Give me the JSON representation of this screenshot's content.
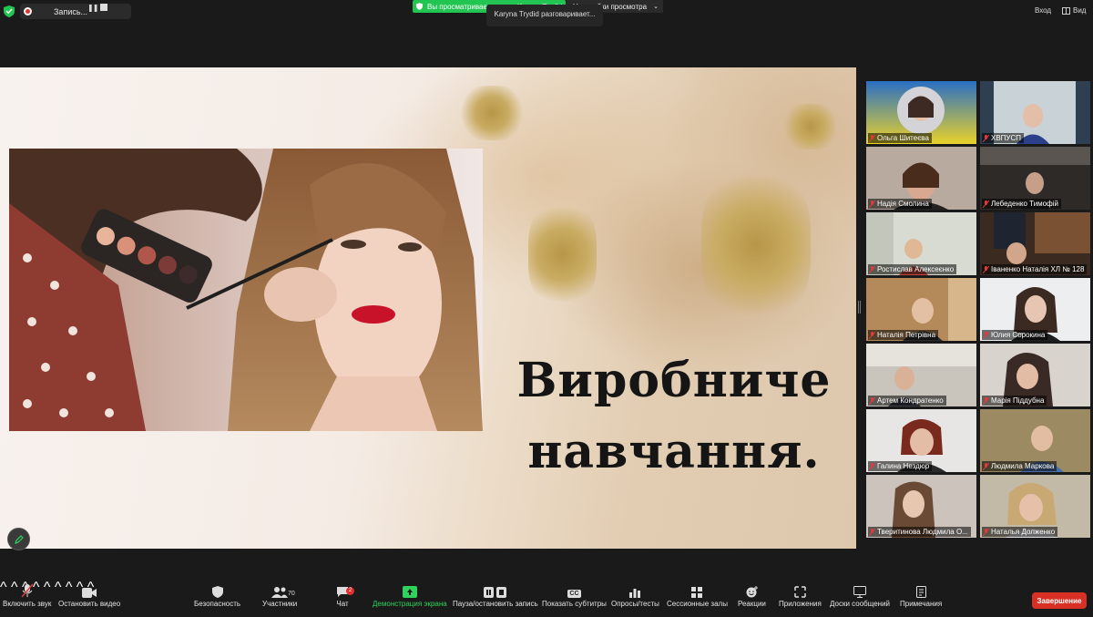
{
  "top_bar": {
    "recording_label": "Запись...",
    "sharing_notice": "Вы просматриваете экран Karyna Trydid",
    "view_options_label": "Настройки просмотра",
    "talking_indicator": "Karyna Trydid разговаривает...",
    "exit_label": "Вход",
    "view_label": "Вид"
  },
  "slide": {
    "title_line1": "Виробниче",
    "title_line2": "навчання."
  },
  "participants": [
    {
      "name": "Ольга Шитеєва"
    },
    {
      "name": "ХВПУСП"
    },
    {
      "name": "Надія Смолина"
    },
    {
      "name": "Лебеденко Тимофій"
    },
    {
      "name": "Ростислав Алексеєнко"
    },
    {
      "name": "Іваненко Наталія ХЛ № 128"
    },
    {
      "name": "Наталія Петрівна"
    },
    {
      "name": "Юлия Сорокина"
    },
    {
      "name": "Артем Кондратенко"
    },
    {
      "name": "Марія Піддубна"
    },
    {
      "name": "Галина Нездюр"
    },
    {
      "name": "Людмила Маркова"
    },
    {
      "name": "Тверитинова Людмила О..."
    },
    {
      "name": "Наталья Долженко"
    }
  ],
  "toolbar": {
    "audio": "Включить звук",
    "video": "Остановить видео",
    "security": "Безопасность",
    "participants": "Участники",
    "participants_count": "70",
    "chat": "Чат",
    "chat_badge": "2",
    "share": "Демонстрация экрана",
    "pause_record": "Пауза/остановить запись",
    "captions": "Показать субтитры",
    "captions_icon_text": "CC",
    "polls": "Опросы/тесты",
    "breakout": "Сессионные залы",
    "reactions": "Реакции",
    "apps": "Приложения",
    "whiteboards": "Доски сообщений",
    "notes": "Примечания",
    "end": "Завершение"
  },
  "colors": {
    "share_green": "#23c552",
    "end_red": "#d93025",
    "background": "#1a1a1a"
  }
}
